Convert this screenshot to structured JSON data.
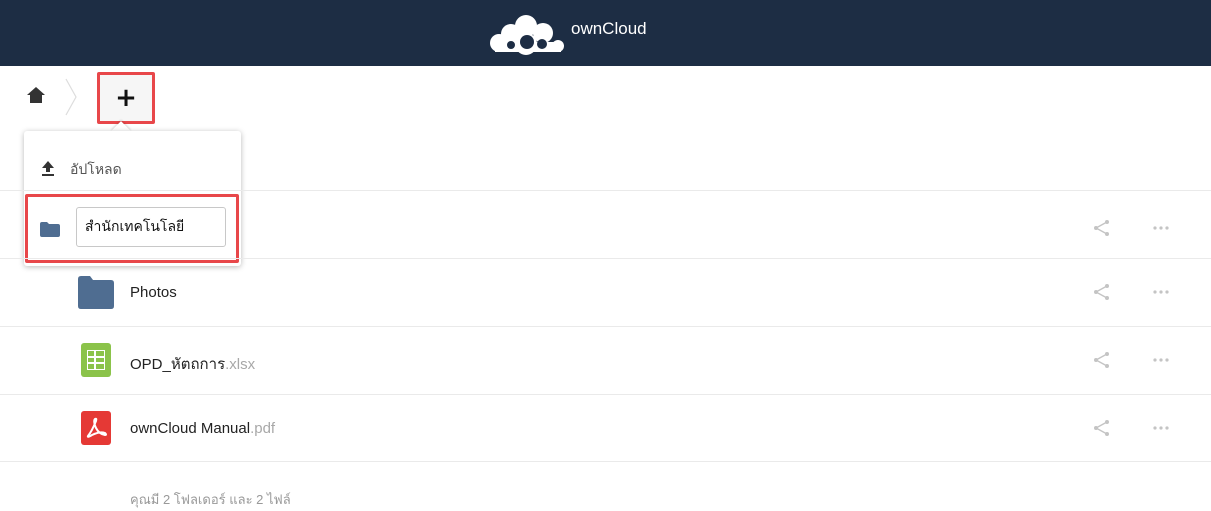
{
  "header": {
    "brand": "ownCloud",
    "logo_icon": "owncloud-logo-icon",
    "background": "#1d2d44"
  },
  "toolbar": {
    "home_icon": "home-icon",
    "new_button_label": "+"
  },
  "new_menu": {
    "upload_label": "อัปโหลด",
    "upload_icon": "upload-icon",
    "folder_icon": "folder-icon",
    "folder_input_value": "สำนักเทคโนโลยี"
  },
  "files": [
    {
      "base": "Photos",
      "ext": "",
      "icon": "folder-icon"
    },
    {
      "base": "OPD_หัตถการ",
      "ext": ".xlsx",
      "icon": "spreadsheet-icon"
    },
    {
      "base": "ownCloud Manual",
      "ext": ".pdf",
      "icon": "pdf-icon"
    }
  ],
  "summary": "คุณมี 2 โฟลเดอร์ และ 2 ไฟล์",
  "colors": {
    "highlight": "#e8474a",
    "folder": "#4f6d91",
    "spreadsheet": "#8bc34a",
    "pdf": "#e53935"
  }
}
